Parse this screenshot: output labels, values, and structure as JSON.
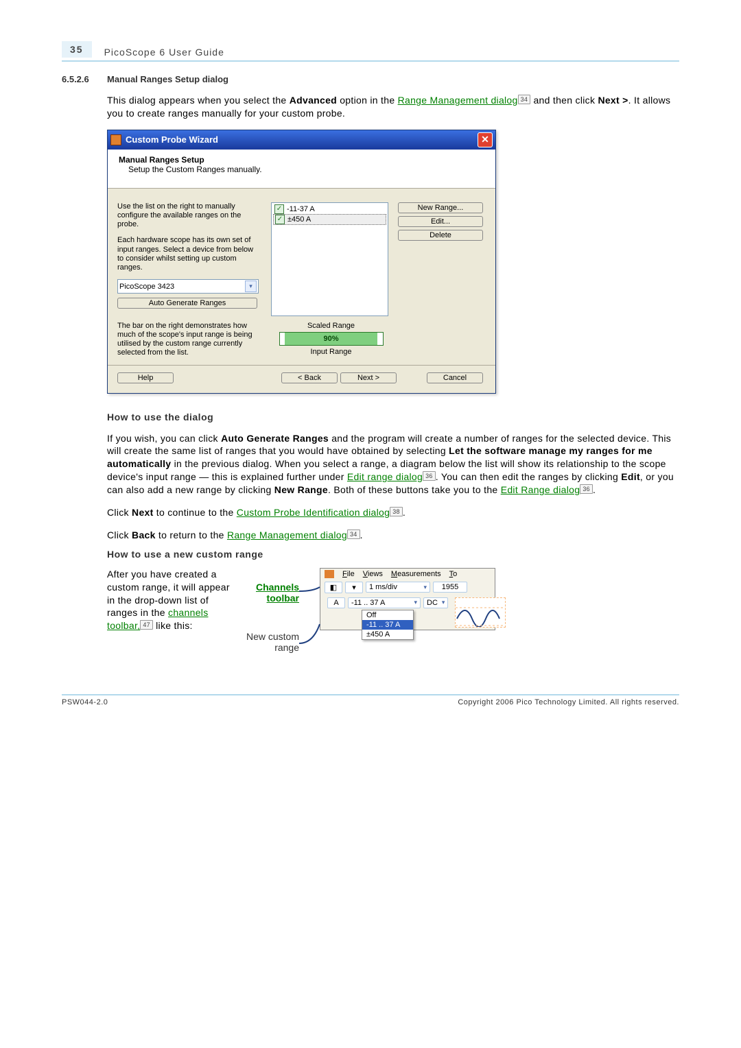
{
  "header": {
    "page_number": "35",
    "doc_title": "PicoScope 6 User Guide"
  },
  "section": {
    "number": "6.5.2.6",
    "title": "Manual Ranges Setup dialog"
  },
  "intro": {
    "t1": "This dialog appears when you select the ",
    "bold1": "Advanced",
    "t2": " option in the ",
    "link1": "Range Management dialog",
    "ref1": "34",
    "t3": " and then click ",
    "bold2": "Next >",
    "t4": ". It allows you to create ranges manually for your custom probe."
  },
  "wizard": {
    "title": "Custom Probe Wizard",
    "heading": "Manual Ranges Setup",
    "subheading": "Setup the Custom Ranges manually.",
    "left_p1": "Use the list on the right to manually configure the available ranges on the probe.",
    "left_p2": "Each hardware scope has its own set of input ranges. Select a device from below to consider whilst setting up custom ranges.",
    "device": "PicoScope 3423",
    "auto_btn": "Auto Generate Ranges",
    "list_items": [
      {
        "label": "-11-37 A",
        "selected": false
      },
      {
        "label": "±450 A",
        "selected": true
      }
    ],
    "btn_new": "New Range...",
    "btn_edit": "Edit...",
    "btn_delete": "Delete",
    "demo_text": "The bar on the right demonstrates how much of the scope's input range is being utilised by the custom range currently selected from the list.",
    "scaled_label": "Scaled Range",
    "percent": "90%",
    "input_label": "Input Range",
    "help": "Help",
    "back": "< Back",
    "next": "Next >",
    "cancel": "Cancel"
  },
  "howto1_heading": "How to use the dialog",
  "para2": {
    "t1": "If you wish, you can click ",
    "b1": "Auto Generate Ranges",
    "t2": " and the program will create a number of ranges for the selected device. This will create the same list of ranges that you would have obtained by selecting ",
    "b2": "Let the software manage my ranges for me automatically",
    "t3": " in the previous dialog. When you select a range, a diagram below the list will show its relationship to the scope device's input range — this is explained further under ",
    "link1": "Edit range dialog",
    "ref1": "36",
    "t4": ". You can then edit the ranges by clicking ",
    "b3": "Edit",
    "t5": ", or you can also add a new range by clicking ",
    "b4": "New Range",
    "t6": ". Both of these buttons take you to the ",
    "link2": "Edit Range dialog",
    "ref2": "36",
    "t7": "."
  },
  "para3": {
    "t1": "Click ",
    "b1": "Next",
    "t2": " to continue to the ",
    "link1": "Custom Probe Identification dialog",
    "ref1": "38",
    "t3": "."
  },
  "para4": {
    "t1": "Click ",
    "b1": "Back",
    "t2": " to return to the ",
    "link1": "Range Management dialog",
    "ref1": "34",
    "t3": "."
  },
  "howto2_heading": "How to use a new custom range",
  "para5": {
    "t1": "After you have created a custom range, it will appear in the drop-down list of ranges in the ",
    "link1": "channels toolbar,",
    "ref1": "47",
    "t2": " like this:"
  },
  "labels": {
    "channels_toolbar": "Channels toolbar",
    "new_custom_range": "New custom range"
  },
  "toolbar": {
    "menu": [
      "File",
      "Views",
      "Measurements",
      "To"
    ],
    "timebase": "1 ms/div",
    "num": "1955",
    "chan": "A",
    "range": "-11 .. 37 A",
    "coupling": "DC",
    "options": [
      "Off",
      "-11 .. 37 A",
      "±450 A"
    ]
  },
  "footer": {
    "left": "PSW044-2.0",
    "right": "Copyright 2006 Pico Technology Limited. All rights reserved."
  }
}
